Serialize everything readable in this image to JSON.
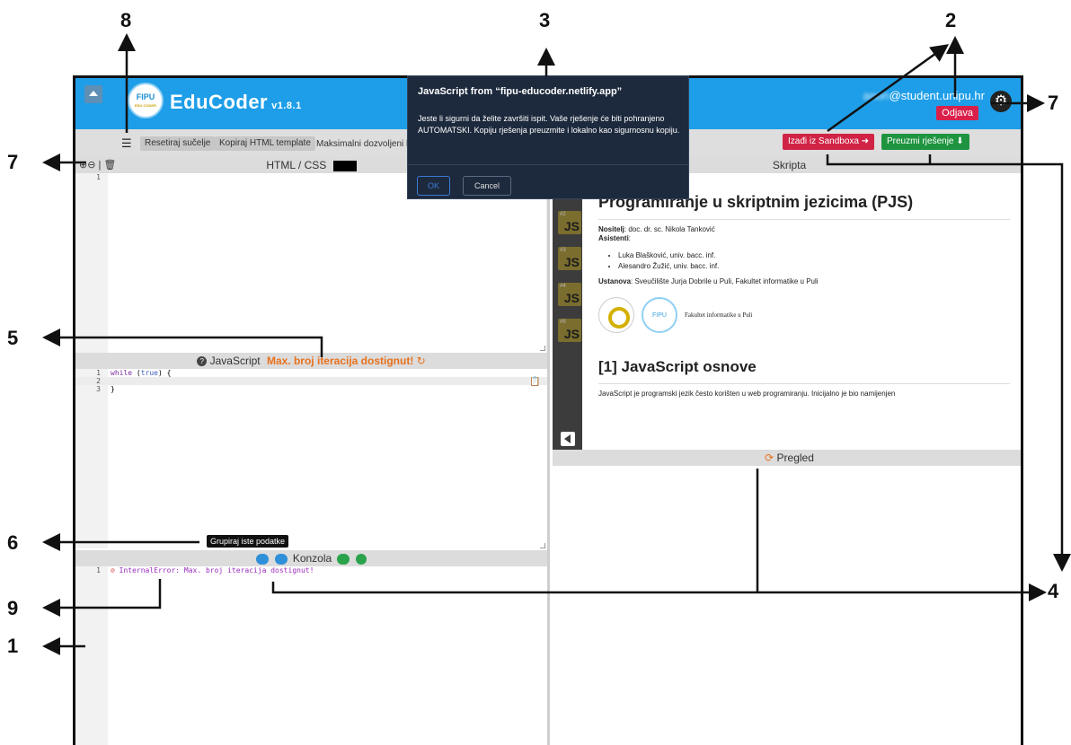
{
  "app": {
    "name": "EduCoder",
    "version": "v1.8.1",
    "logo_top": "FIPU",
    "logo_bottom": "EDU CODER",
    "user_blur": "anon",
    "user_domain": "@student.unipu.hr",
    "logout": "Odjava"
  },
  "toolbar": {
    "reset": "Resetiraj sučelje",
    "copy": "Kopiraj HTML template",
    "max_text": "Maksimalni dozvoljeni b",
    "exit_sandbox": "Izađi iz Sandboxa",
    "download": "Preuzmi rješenje"
  },
  "html_pane": {
    "title": "HTML / CSS",
    "lines": [
      "1"
    ]
  },
  "js_pane": {
    "title": "JavaScript",
    "warning": "Max. broj iteracija dostignut!",
    "code": {
      "kw": "while",
      "open": " (",
      "cons": "true",
      "close": ") {",
      "end": "}"
    },
    "lines": [
      "1",
      "2",
      "3"
    ]
  },
  "console": {
    "title": "Konzola",
    "tooltip": "Grupiraj iste podatke",
    "line": "1",
    "error": "InternalError: Max. broj iteracija dostignut!"
  },
  "script_pane": {
    "title": "Skripta",
    "sidebar": [
      {
        "n": "#2",
        "label": "JS"
      },
      {
        "n": "#3",
        "label": "JS"
      },
      {
        "n": "#4",
        "label": "JS"
      },
      {
        "n": "#5",
        "label": "JS"
      }
    ]
  },
  "preview": {
    "title": "Pregled"
  },
  "doc": {
    "h1": "Programiranje u skriptnim jezicima (PJS)",
    "nositelj_label": "Nositelj",
    "nositelj": ": doc. dr. sc. Nikola Tanković",
    "asistenti": "Asistenti",
    "assistants": [
      "Luka Blašković, univ. bacc. inf.",
      "Alesandro Žužić, univ. bacc. inf."
    ],
    "ustanova_label": "Ustanova",
    "ustanova": ": Sveučilište Jurja Dobrile u Puli, Fakultet informatike u Puli",
    "seal2": "FIPU",
    "faculty": "Fakultet informatike u Puli",
    "h2": "[1] JavaScript osnove",
    "intro": "JavaScript je programski jezik često korišten u web programiranju. Inicijalno je bio namijenjen"
  },
  "dialog": {
    "title": "JavaScript from “fipu-educoder.netlify.app”",
    "message": "Jeste li sigurni da želite završiti ispit. Vaše rješenje će biti pohranjeno AUTOMATSKI. Kopiju rješenja preuzmite i lokalno kao sigurnosnu kopiju.",
    "ok": "OK",
    "cancel": "Cancel"
  },
  "callouts": {
    "c1": "1",
    "c2": "2",
    "c3": "3",
    "c4": "4",
    "c5": "5",
    "c6": "6",
    "c7": "7",
    "c8": "8",
    "c9": "9"
  },
  "colors": {
    "topbar": "#1e9ee8",
    "warning": "#e8711c",
    "error": "#d43c3c",
    "dialog": "#1d2a3d"
  }
}
